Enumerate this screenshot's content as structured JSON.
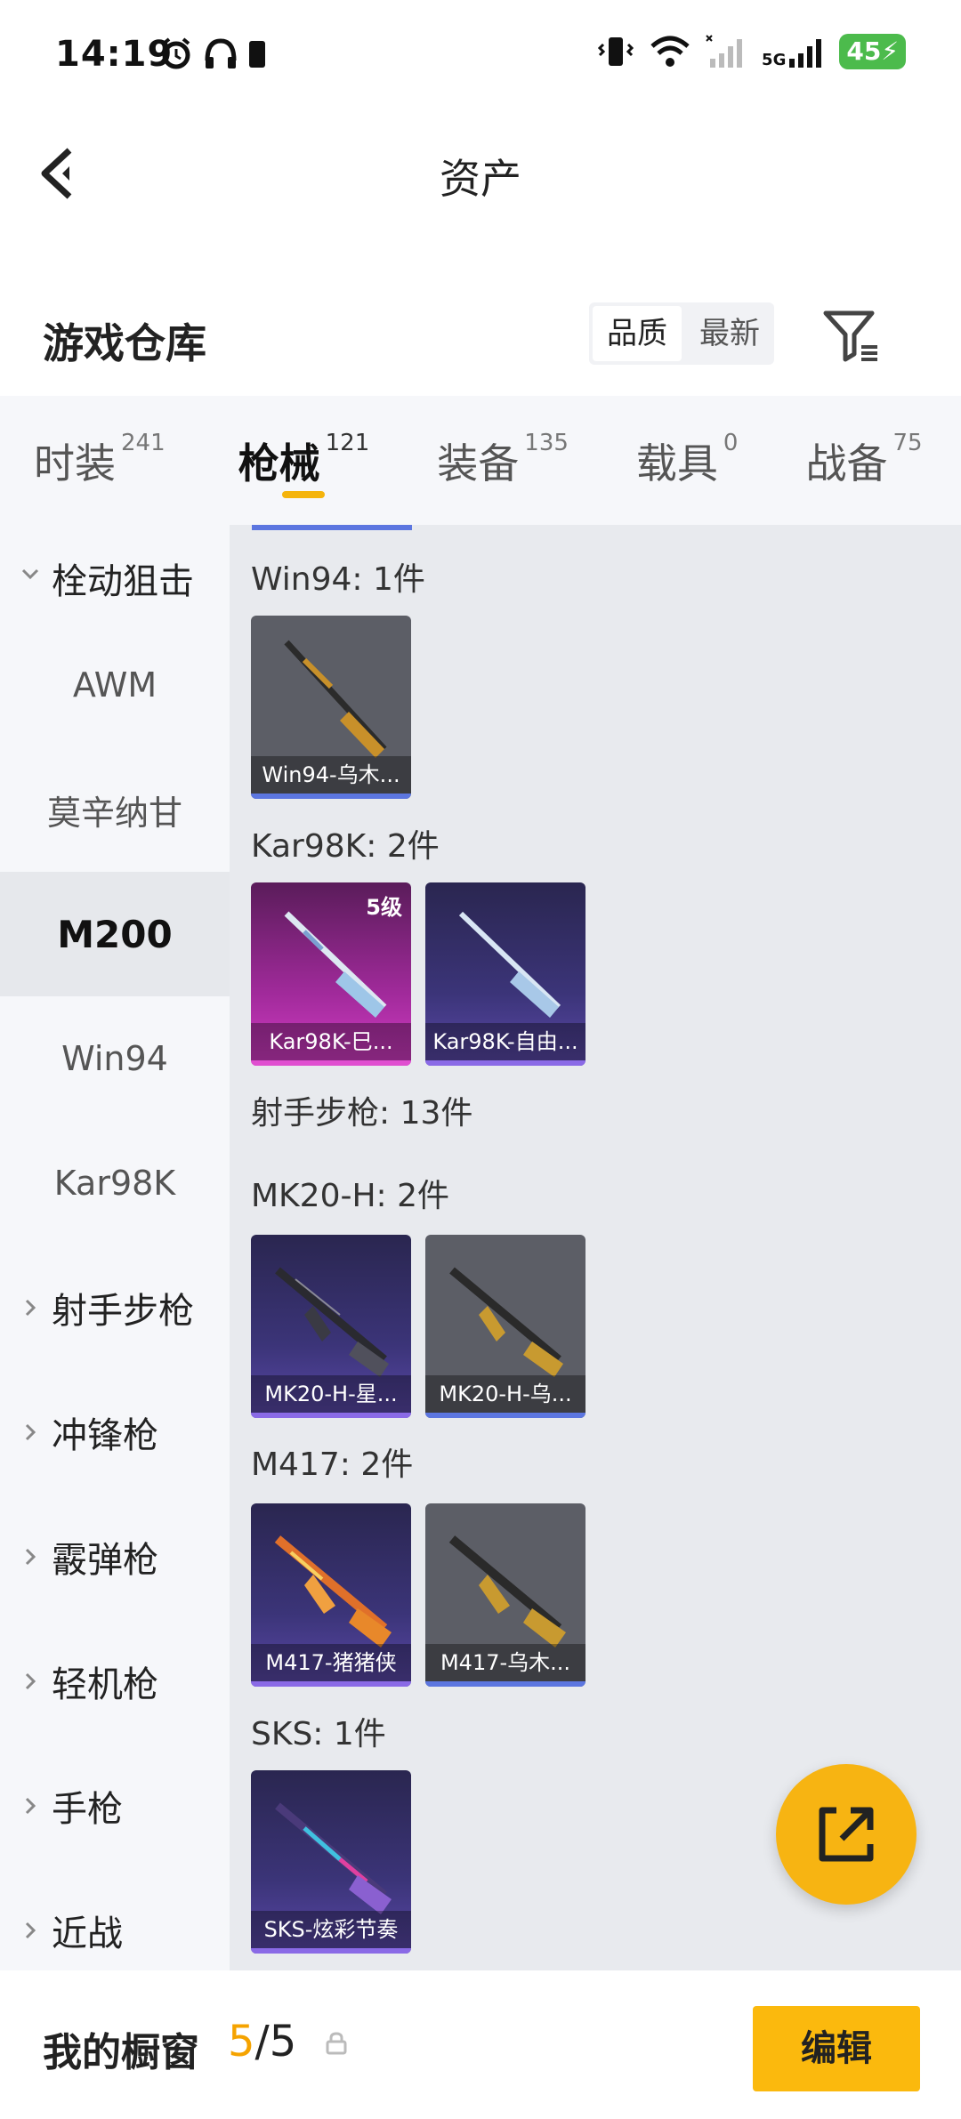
{
  "status_bar": {
    "time": "14:19",
    "network_label": "5G",
    "battery": "45"
  },
  "header": {
    "title": "资产"
  },
  "section": {
    "title": "游戏仓库",
    "sort_options": [
      "品质",
      "最新"
    ],
    "sort_selected": "品质"
  },
  "tabs": [
    {
      "label": "时装",
      "count": "241"
    },
    {
      "label": "枪械",
      "count": "121"
    },
    {
      "label": "装备",
      "count": "135"
    },
    {
      "label": "载具",
      "count": "0"
    },
    {
      "label": "战备",
      "count": "75"
    }
  ],
  "active_tab": "枪械",
  "sidebar": {
    "items": [
      {
        "label": "栓动狙击",
        "type": "group",
        "expanded": true
      },
      {
        "label": "AWM",
        "type": "sub"
      },
      {
        "label": "莫辛纳甘",
        "type": "sub"
      },
      {
        "label": "M200",
        "type": "sub",
        "selected": true
      },
      {
        "label": "Win94",
        "type": "sub"
      },
      {
        "label": "Kar98K",
        "type": "sub"
      },
      {
        "label": "射手步枪",
        "type": "group"
      },
      {
        "label": "冲锋枪",
        "type": "group"
      },
      {
        "label": "霰弹枪",
        "type": "group"
      },
      {
        "label": "轻机枪",
        "type": "group"
      },
      {
        "label": "手枪",
        "type": "group"
      },
      {
        "label": "近战",
        "type": "group"
      }
    ]
  },
  "content": {
    "groups": [
      {
        "heading": "Win94: 1件",
        "items": [
          {
            "name": "Win94-乌木...",
            "quality": "gray",
            "bar_color": "#5c76e0"
          }
        ]
      },
      {
        "heading": "Kar98K: 2件",
        "items": [
          {
            "name": "Kar98K-巳...",
            "quality": "pink",
            "level": "5级",
            "bar_color": "#e04fd0"
          },
          {
            "name": "Kar98K-自由...",
            "quality": "purple",
            "bar_color": "#8a6ae6"
          }
        ]
      },
      {
        "heading": "射手步枪: 13件",
        "items": []
      },
      {
        "heading": "MK20-H: 2件",
        "items": [
          {
            "name": "MK20-H-星...",
            "quality": "purple",
            "bar_color": "#8a6ae6"
          },
          {
            "name": "MK20-H-乌...",
            "quality": "gray",
            "bar_color": "#5c76e0"
          }
        ]
      },
      {
        "heading": "M417: 2件",
        "items": [
          {
            "name": "M417-猪猪侠",
            "quality": "purple",
            "bar_color": "#8a6ae6"
          },
          {
            "name": "M417-乌木...",
            "quality": "gray",
            "bar_color": "#5c76e0"
          }
        ]
      },
      {
        "heading": "SKS: 1件",
        "items": [
          {
            "name": "SKS-炫彩节奏",
            "quality": "purple",
            "bar_color": "#8a6ae6"
          }
        ]
      }
    ]
  },
  "bottom_bar": {
    "label": "我的橱窗",
    "count_current": "5",
    "count_total": "/5",
    "edit_label": "编辑"
  },
  "colors": {
    "accent": "#f5b40c",
    "fab": "#f7b412"
  }
}
